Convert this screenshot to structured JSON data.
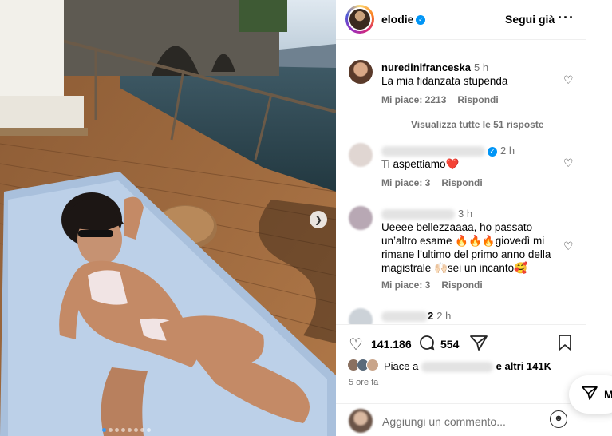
{
  "post": {
    "username": "elodie",
    "follow_label": "Segui già",
    "more_label": "···",
    "carousel_dots": 8
  },
  "comments": [
    {
      "user": "nuredinifranceska",
      "time": "5 h",
      "text": "La mia fidanzata stupenda",
      "likes": "Mi piace: 2213",
      "reply": "Rispondi"
    },
    {
      "replies_label": "Visualizza tutte le 51 risposte"
    },
    {
      "user": "",
      "time": "2 h",
      "text": "Ti aspettiamo❤️",
      "likes": "Mi piace: 3",
      "reply": "Rispondi"
    },
    {
      "user": "",
      "time": "3 h",
      "text": "Ueeee bellezzaaaa, ho passato un’altro esame 🔥🔥🔥giovedì mi rimane l’ultimo del primo anno della magistrale 🙌🏻sei un incanto🥰",
      "likes": "Mi piace: 3",
      "reply": "Rispondi"
    },
    {
      "user_suffix": "2",
      "time": "2 h"
    }
  ],
  "actions": {
    "likes_count": "141.186",
    "comments_count": "554"
  },
  "liked_by": {
    "prefix": "Piace a",
    "suffix": "e altri 141K"
  },
  "time_ago": "5 ore fa",
  "add_comment": {
    "placeholder": "Aggiungi un commento..."
  },
  "messages_float": {
    "label": "M"
  },
  "icons": {
    "heart": "heart-icon",
    "comment": "comment-icon",
    "share": "share-icon",
    "save": "bookmark-icon",
    "emoji": "emoji-icon",
    "next": "chevron-right-icon"
  },
  "colors": {
    "verified": "#0095f6",
    "muted": "#737373",
    "active_dot": "#3897f0"
  }
}
